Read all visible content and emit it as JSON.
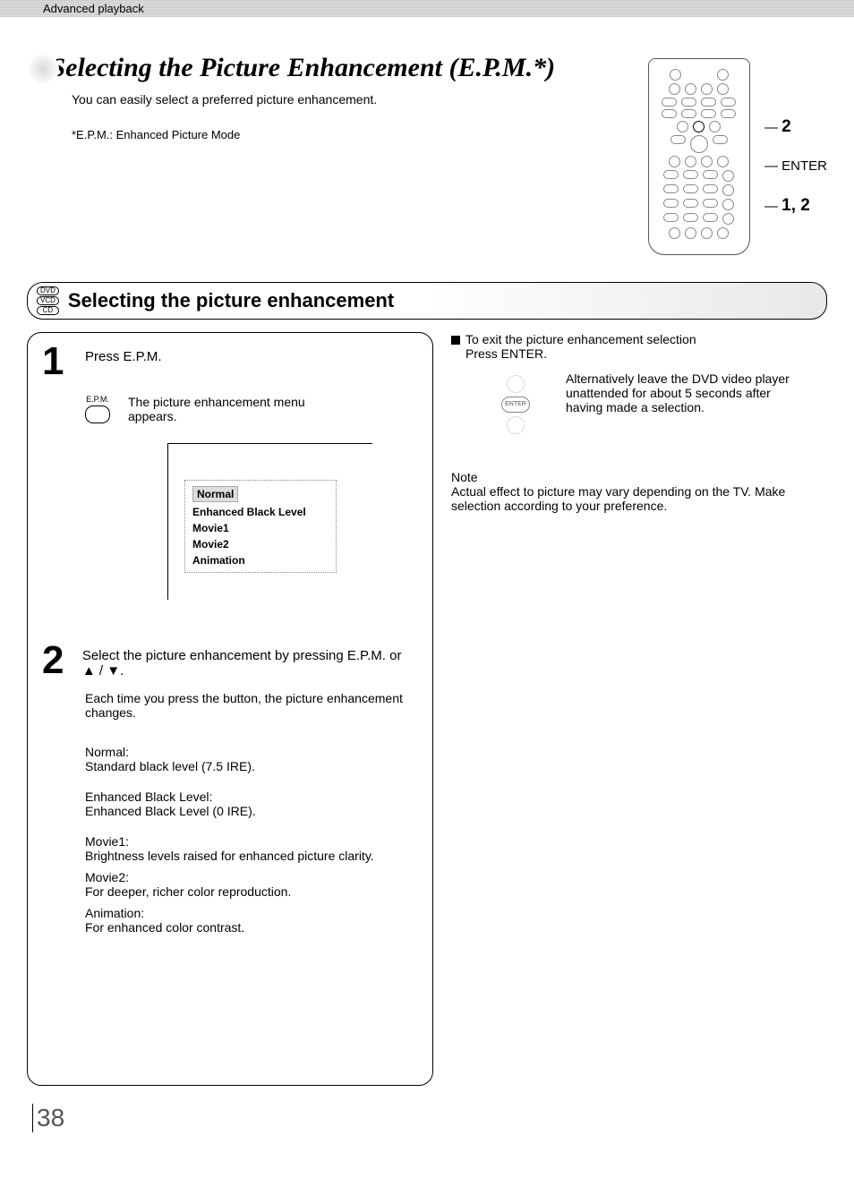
{
  "header": {
    "breadcrumb": "Advanced playback"
  },
  "title": {
    "main": "Selecting the Picture Enhancement (E.P.M.*)",
    "intro": "You can easily select a preferred picture enhancement.",
    "footnote": "*E.P.M.: Enhanced Picture Mode"
  },
  "remote_callouts": {
    "c1": "2",
    "c2": "ENTER",
    "c3": "1, 2"
  },
  "disc_types": {
    "a": "DVD",
    "b": "VCD",
    "c": "CD"
  },
  "section": {
    "title": "Selecting the picture enhancement"
  },
  "step1": {
    "num": "1",
    "instruction": "Press E.P.M.",
    "button_label": "E.P.M.",
    "sub": "The picture enhancement menu appears.",
    "menu": {
      "opt1": "Normal",
      "opt2": "Enhanced Black Level",
      "opt3": "Movie1",
      "opt4": "Movie2",
      "opt5": "Animation"
    }
  },
  "step2": {
    "num": "2",
    "instruction": "Select the picture enhancement by pressing E.P.M. or ▲ / ▼.",
    "desc": "Each time you press the button, the picture enhancement changes.",
    "modes": {
      "m1_title": "Normal:",
      "m1_desc": "Standard black level (7.5 IRE).",
      "m2_title": "Enhanced Black Level:",
      "m2_desc": "Enhanced Black Level (0 IRE).",
      "m3_title": "Movie1:",
      "m3_desc": "Brightness levels raised for enhanced picture clarity.",
      "m4_title": "Movie2:",
      "m4_desc": "For deeper, richer color reproduction.",
      "m5_title": "Animation:",
      "m5_desc": "For enhanced color contrast."
    }
  },
  "right": {
    "exit_heading": "To exit the picture enhancement selection",
    "exit_instruction": "Press ENTER.",
    "enter_label": "ENTER",
    "alt_text": "Alternatively leave the DVD video player unattended for about 5 seconds after having made a selection.",
    "note_heading": "Note",
    "note_text": "Actual effect to picture may vary depending on the TV.  Make selection according to your preference."
  },
  "page_number": "38"
}
